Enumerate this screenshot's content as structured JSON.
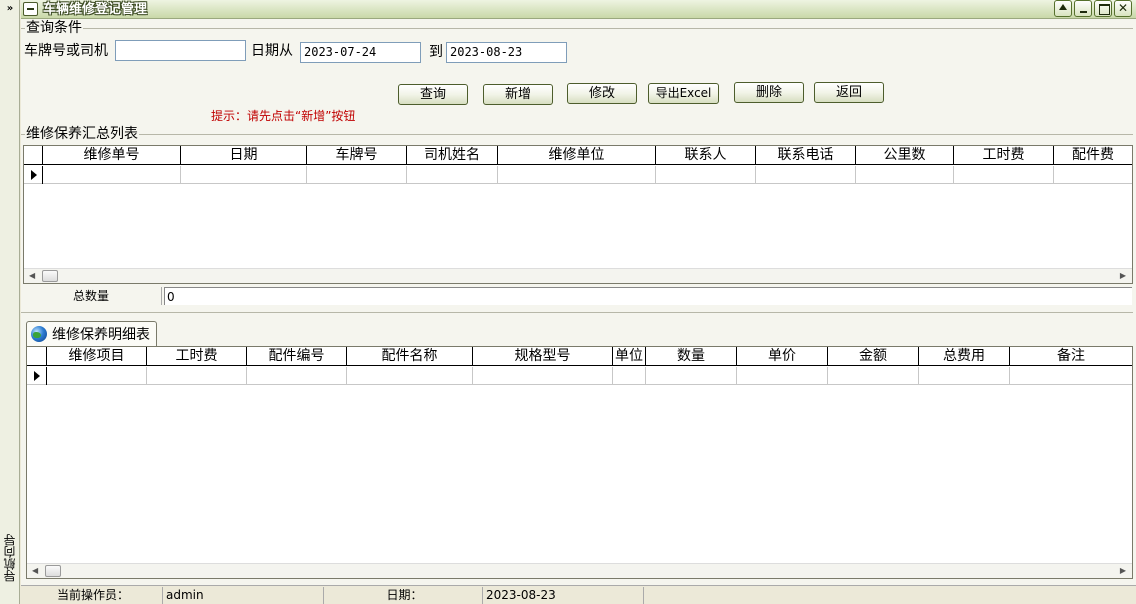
{
  "nav": {
    "toggle": "»",
    "label": "导航向导"
  },
  "window": {
    "title": "车辆维修登记管理"
  },
  "query": {
    "group_title": "查询条件",
    "plate_label": "车牌号或司机",
    "plate_value": "",
    "date_from_label": "日期从",
    "date_from": "2023-07-24",
    "date_to_label": "到",
    "date_to": "2023-08-23",
    "buttons": {
      "search": "查询",
      "add": "新增",
      "edit": "修改",
      "export": "导出Excel",
      "delete": "删除",
      "back": "返回"
    },
    "hint": "提示：请先点击“新增”按钮"
  },
  "summary_table": {
    "group_title": "维修保养汇总列表",
    "columns": [
      "维修单号",
      "日期",
      "车牌号",
      "司机姓名",
      "维修单位",
      "联系人",
      "联系电话",
      "公里数",
      "工时费",
      "配件费"
    ],
    "total_label": "总数量",
    "total_value": "0"
  },
  "detail_table": {
    "tab_label": "维修保养明细表",
    "columns": [
      "维修项目",
      "工时费",
      "配件编号",
      "配件名称",
      "规格型号",
      "单位",
      "数量",
      "单价",
      "金额",
      "总费用",
      "备注"
    ]
  },
  "status": {
    "operator_label": "当前操作员：",
    "operator": "admin",
    "date_label": "日期：",
    "date": "2023-08-23"
  }
}
